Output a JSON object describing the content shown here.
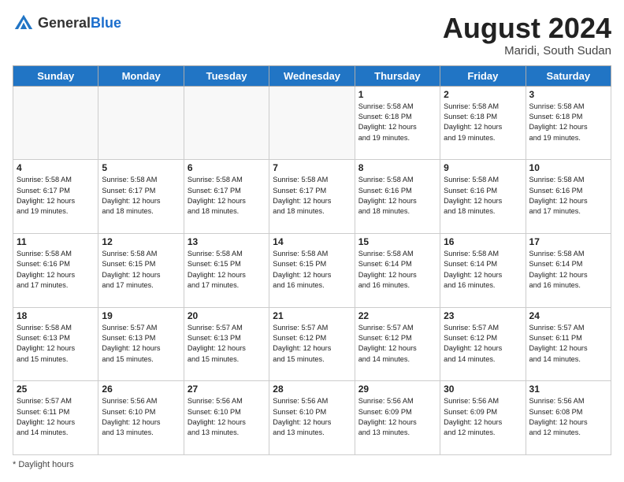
{
  "header": {
    "logo_general": "General",
    "logo_blue": "Blue",
    "month_year": "August 2024",
    "location": "Maridi, South Sudan"
  },
  "days_of_week": [
    "Sunday",
    "Monday",
    "Tuesday",
    "Wednesday",
    "Thursday",
    "Friday",
    "Saturday"
  ],
  "footer": {
    "note": "Daylight hours"
  },
  "weeks": [
    [
      {
        "day": "",
        "info": ""
      },
      {
        "day": "",
        "info": ""
      },
      {
        "day": "",
        "info": ""
      },
      {
        "day": "",
        "info": ""
      },
      {
        "day": "1",
        "info": "Sunrise: 5:58 AM\nSunset: 6:18 PM\nDaylight: 12 hours\nand 19 minutes."
      },
      {
        "day": "2",
        "info": "Sunrise: 5:58 AM\nSunset: 6:18 PM\nDaylight: 12 hours\nand 19 minutes."
      },
      {
        "day": "3",
        "info": "Sunrise: 5:58 AM\nSunset: 6:18 PM\nDaylight: 12 hours\nand 19 minutes."
      }
    ],
    [
      {
        "day": "4",
        "info": "Sunrise: 5:58 AM\nSunset: 6:17 PM\nDaylight: 12 hours\nand 19 minutes."
      },
      {
        "day": "5",
        "info": "Sunrise: 5:58 AM\nSunset: 6:17 PM\nDaylight: 12 hours\nand 18 minutes."
      },
      {
        "day": "6",
        "info": "Sunrise: 5:58 AM\nSunset: 6:17 PM\nDaylight: 12 hours\nand 18 minutes."
      },
      {
        "day": "7",
        "info": "Sunrise: 5:58 AM\nSunset: 6:17 PM\nDaylight: 12 hours\nand 18 minutes."
      },
      {
        "day": "8",
        "info": "Sunrise: 5:58 AM\nSunset: 6:16 PM\nDaylight: 12 hours\nand 18 minutes."
      },
      {
        "day": "9",
        "info": "Sunrise: 5:58 AM\nSunset: 6:16 PM\nDaylight: 12 hours\nand 18 minutes."
      },
      {
        "day": "10",
        "info": "Sunrise: 5:58 AM\nSunset: 6:16 PM\nDaylight: 12 hours\nand 17 minutes."
      }
    ],
    [
      {
        "day": "11",
        "info": "Sunrise: 5:58 AM\nSunset: 6:16 PM\nDaylight: 12 hours\nand 17 minutes."
      },
      {
        "day": "12",
        "info": "Sunrise: 5:58 AM\nSunset: 6:15 PM\nDaylight: 12 hours\nand 17 minutes."
      },
      {
        "day": "13",
        "info": "Sunrise: 5:58 AM\nSunset: 6:15 PM\nDaylight: 12 hours\nand 17 minutes."
      },
      {
        "day": "14",
        "info": "Sunrise: 5:58 AM\nSunset: 6:15 PM\nDaylight: 12 hours\nand 16 minutes."
      },
      {
        "day": "15",
        "info": "Sunrise: 5:58 AM\nSunset: 6:14 PM\nDaylight: 12 hours\nand 16 minutes."
      },
      {
        "day": "16",
        "info": "Sunrise: 5:58 AM\nSunset: 6:14 PM\nDaylight: 12 hours\nand 16 minutes."
      },
      {
        "day": "17",
        "info": "Sunrise: 5:58 AM\nSunset: 6:14 PM\nDaylight: 12 hours\nand 16 minutes."
      }
    ],
    [
      {
        "day": "18",
        "info": "Sunrise: 5:58 AM\nSunset: 6:13 PM\nDaylight: 12 hours\nand 15 minutes."
      },
      {
        "day": "19",
        "info": "Sunrise: 5:57 AM\nSunset: 6:13 PM\nDaylight: 12 hours\nand 15 minutes."
      },
      {
        "day": "20",
        "info": "Sunrise: 5:57 AM\nSunset: 6:13 PM\nDaylight: 12 hours\nand 15 minutes."
      },
      {
        "day": "21",
        "info": "Sunrise: 5:57 AM\nSunset: 6:12 PM\nDaylight: 12 hours\nand 15 minutes."
      },
      {
        "day": "22",
        "info": "Sunrise: 5:57 AM\nSunset: 6:12 PM\nDaylight: 12 hours\nand 14 minutes."
      },
      {
        "day": "23",
        "info": "Sunrise: 5:57 AM\nSunset: 6:12 PM\nDaylight: 12 hours\nand 14 minutes."
      },
      {
        "day": "24",
        "info": "Sunrise: 5:57 AM\nSunset: 6:11 PM\nDaylight: 12 hours\nand 14 minutes."
      }
    ],
    [
      {
        "day": "25",
        "info": "Sunrise: 5:57 AM\nSunset: 6:11 PM\nDaylight: 12 hours\nand 14 minutes."
      },
      {
        "day": "26",
        "info": "Sunrise: 5:56 AM\nSunset: 6:10 PM\nDaylight: 12 hours\nand 13 minutes."
      },
      {
        "day": "27",
        "info": "Sunrise: 5:56 AM\nSunset: 6:10 PM\nDaylight: 12 hours\nand 13 minutes."
      },
      {
        "day": "28",
        "info": "Sunrise: 5:56 AM\nSunset: 6:10 PM\nDaylight: 12 hours\nand 13 minutes."
      },
      {
        "day": "29",
        "info": "Sunrise: 5:56 AM\nSunset: 6:09 PM\nDaylight: 12 hours\nand 13 minutes."
      },
      {
        "day": "30",
        "info": "Sunrise: 5:56 AM\nSunset: 6:09 PM\nDaylight: 12 hours\nand 12 minutes."
      },
      {
        "day": "31",
        "info": "Sunrise: 5:56 AM\nSunset: 6:08 PM\nDaylight: 12 hours\nand 12 minutes."
      }
    ]
  ]
}
